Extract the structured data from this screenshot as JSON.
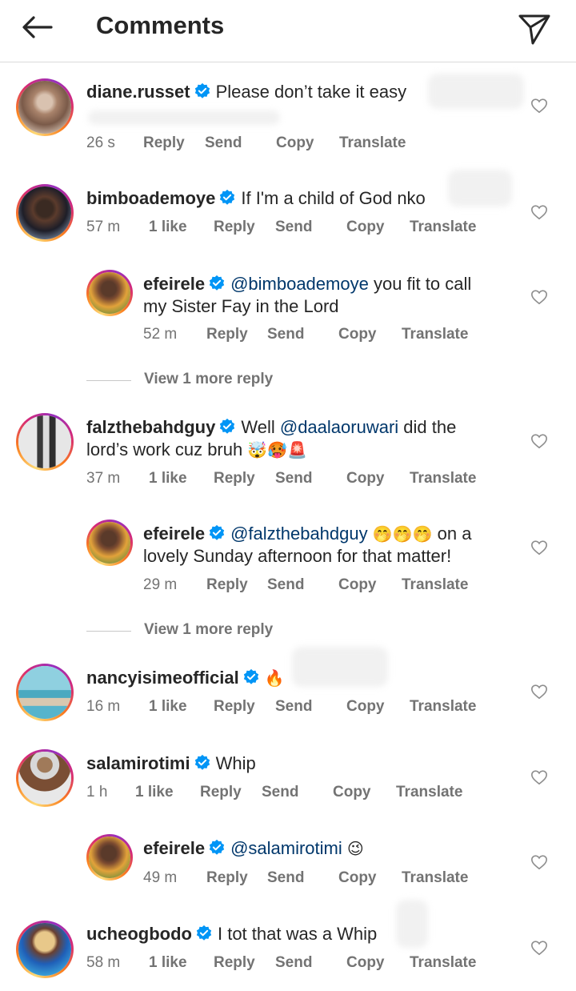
{
  "header": {
    "title": "Comments"
  },
  "actions": {
    "reply": "Reply",
    "send": "Send",
    "copy": "Copy",
    "translate": "Translate"
  },
  "comments": [
    {
      "username": "diane.russet",
      "text": "Please don’t take it easy",
      "time": "26 s",
      "likes": ""
    },
    {
      "username": "bimboademoye",
      "text": "If I'm a child of God nko",
      "time": "57 m",
      "likes": "1 like",
      "replies": [
        {
          "username": "efeirele",
          "mention": "@bimboademoye",
          "text_line1": "you fit to call",
          "text_line2": "my Sister Fay in the Lord",
          "time": "52 m"
        }
      ],
      "more_replies": "View 1 more reply"
    },
    {
      "username": "falzthebahdguy",
      "pre": "Well",
      "mention": "@daalaoruwari",
      "text_line1": "did the",
      "text_line2": "lord’s work cuz bruh",
      "emojis": "🤯🥵🚨",
      "time": "37 m",
      "likes": "1 like",
      "replies": [
        {
          "username": "efeirele",
          "mention": "@falzthebahdguy",
          "emojis": "🤭🤭🤭",
          "text_line1": "on a",
          "text_line2": "lovely Sunday afternoon for that matter!",
          "time": "29 m"
        }
      ],
      "more_replies": "View 1 more reply"
    },
    {
      "username": "nancyisimeofficial",
      "text": "🔥",
      "time": "16 m",
      "likes": "1 like"
    },
    {
      "username": "salamirotimi",
      "text": "Whip",
      "time": "1 h",
      "likes": "1 like",
      "replies": [
        {
          "username": "efeirele",
          "mention": "@salamirotimi",
          "emojis": "😉",
          "time": "49 m"
        }
      ]
    },
    {
      "username": "ucheogbodo",
      "text": "I tot that was a Whip",
      "time": "58 m",
      "likes": "1 like"
    }
  ]
}
